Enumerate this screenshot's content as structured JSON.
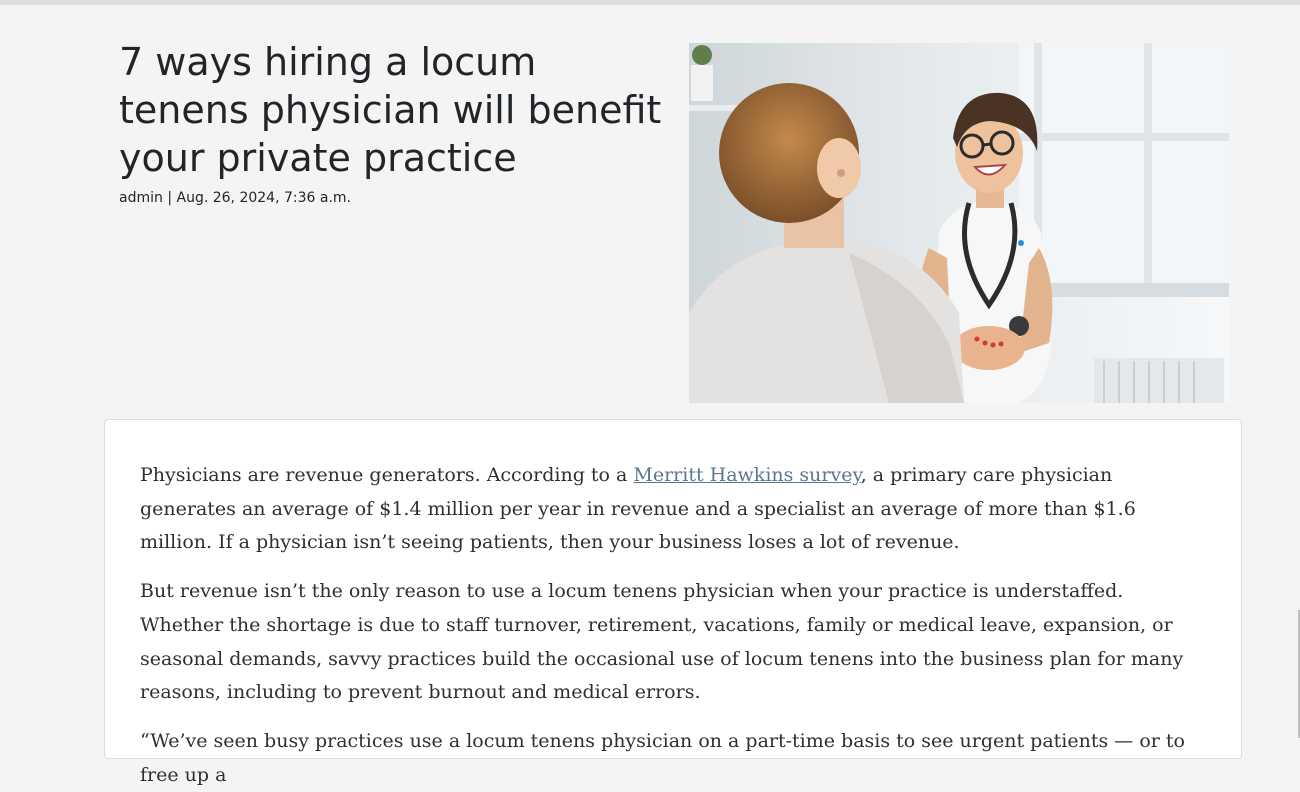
{
  "post": {
    "title": "7 ways hiring a locum tenens physician will benefit your private practice",
    "author": "admin",
    "separator": " | ",
    "date": "Aug. 26, 2024, 7:36 a.m."
  },
  "hero_image": {
    "icon": "photo-doctor-and-patient"
  },
  "article": {
    "p1_before_link": "Physicians are revenue generators. According to a ",
    "p1_link": "Merritt Hawkins survey",
    "p1_after_link": ", a primary care physician generates an average of $1.4 million per year in revenue and a specialist an average of more than $1.6 million. If a physician isn’t seeing patients, then your business loses a lot of revenue.",
    "p2": "But revenue isn’t the only reason to use a locum tenens physician when your practice is understaffed. Whether the shortage is due to staff turnover, retirement, vacations, family or medical leave, expansion, or seasonal demands, savvy practices build the occasional use of locum tenens into the business plan for many reasons, including to prevent burnout and medical errors.",
    "p3": "“We’ve seen busy practices use a locum tenens physician on a part-time basis to see urgent patients — or to free up a"
  },
  "colors": {
    "page_background": "#f4f4f4",
    "card_background": "#ffffff",
    "link": "#5a7690",
    "text": "#212529"
  }
}
